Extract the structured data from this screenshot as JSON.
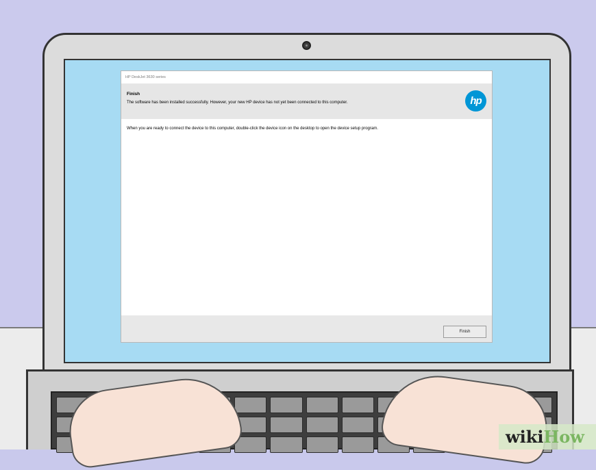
{
  "dialog": {
    "window_title": "HP DeskJet 3630 series",
    "header_title": "Finish",
    "header_message": "The software has been installed successfully.  However, your new HP device has not yet been connected to this computer.",
    "logo_text": "hp",
    "body_text": "When you are ready to connect the device to this computer, double-click the device icon on the desktop to open the device setup program.",
    "finish_button": "Finish"
  },
  "watermark": {
    "part1": "wiki",
    "part2": "How"
  },
  "colors": {
    "hp_blue": "#0096d6",
    "screen_background": "#a7dbf3",
    "wall": "#cbcaed"
  }
}
